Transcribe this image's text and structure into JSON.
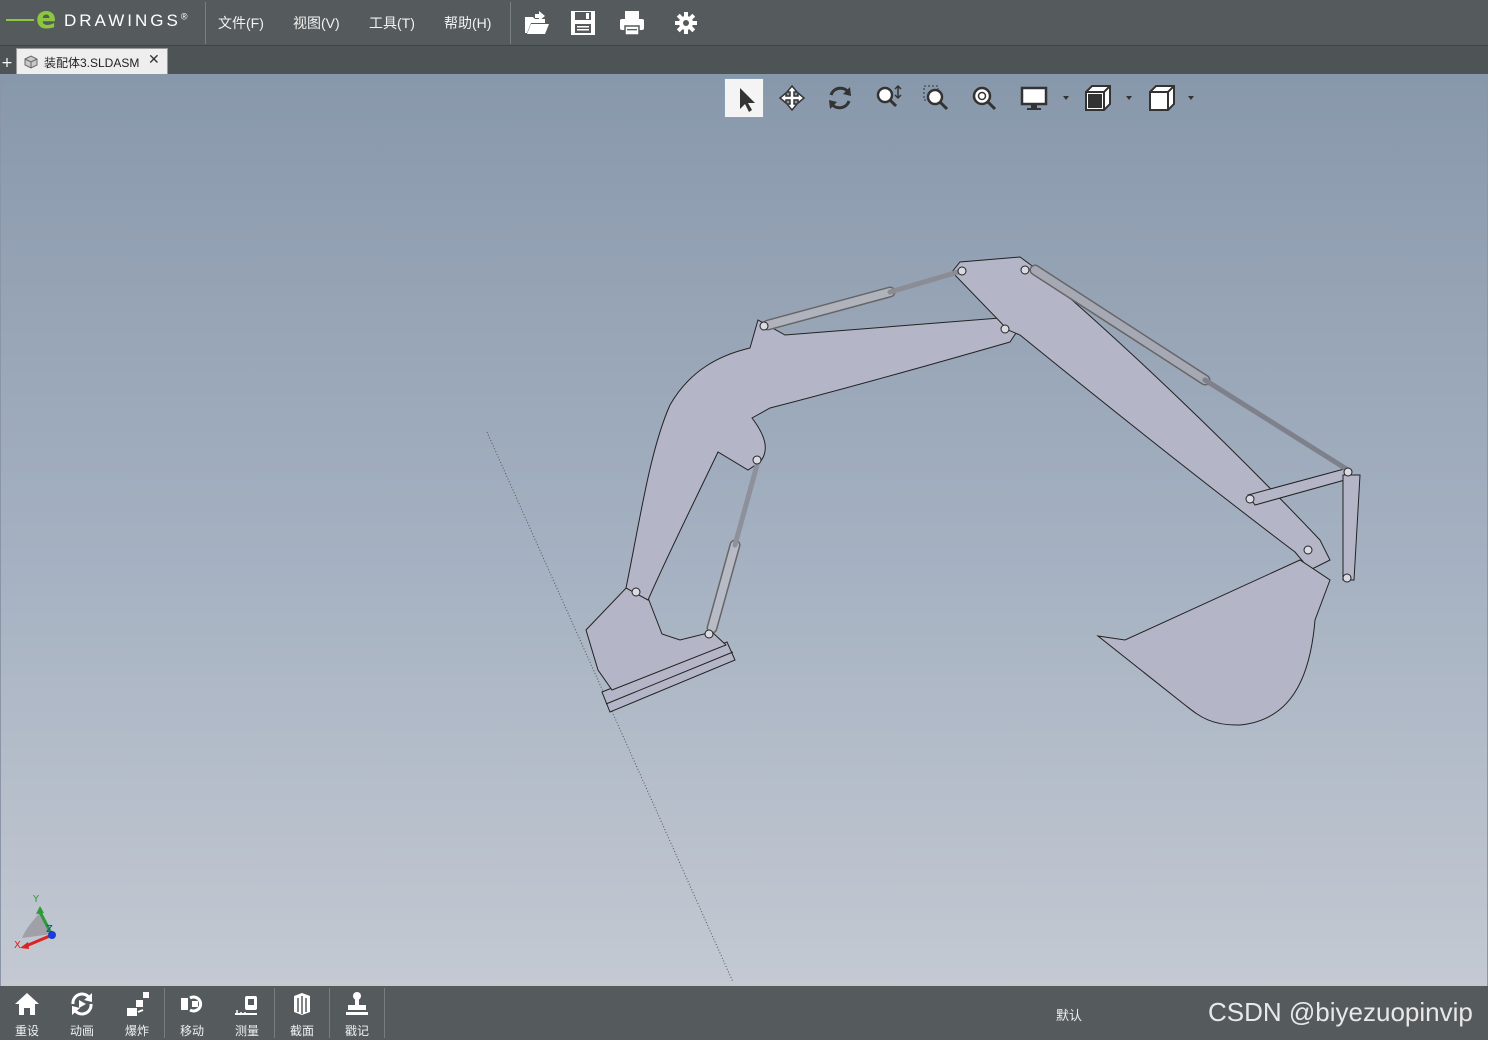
{
  "app": {
    "logo_letter": "e",
    "logo_text": "DRAWINGS",
    "logo_mark": "®"
  },
  "menu": {
    "items": [
      "文件(F)",
      "视图(V)",
      "工具(T)",
      "帮助(H)"
    ]
  },
  "toolbar": {
    "icons": [
      "open-icon",
      "save-icon",
      "print-icon",
      "gear-icon"
    ]
  },
  "document_tab": {
    "new_tab_symbol": "+",
    "label": "装配体3.SLDASM",
    "close_symbol": "✕"
  },
  "view_toolbar": {
    "icons": [
      "select-arrow-icon",
      "pan-icon",
      "rotate-icon",
      "zoom-to-fit-icon",
      "zoom-area-icon",
      "zoom-icon",
      "display-style-icon",
      "view-orientation-icon",
      "standard-views-icon"
    ],
    "selected": "select-arrow-icon"
  },
  "triad": {
    "x_label": "X",
    "y_label": "Y",
    "z_label": "Z"
  },
  "bottom_tools": {
    "items": [
      {
        "label": "重设",
        "icon": "home-icon"
      },
      {
        "label": "动画",
        "icon": "animate-icon"
      },
      {
        "label": "爆炸",
        "icon": "explode-icon"
      },
      {
        "label": "移动",
        "icon": "move-icon"
      },
      {
        "label": "测量",
        "icon": "measure-icon"
      },
      {
        "label": "截面",
        "icon": "section-icon"
      },
      {
        "label": "戳记",
        "icon": "stamp-icon"
      }
    ]
  },
  "status": {
    "configuration": "默认"
  },
  "watermark": "CSDN @biyezuopinvip",
  "colors": {
    "accent": "#8dc63f",
    "chrome": "#555b5c",
    "model_fill": "#b4b6c8"
  }
}
